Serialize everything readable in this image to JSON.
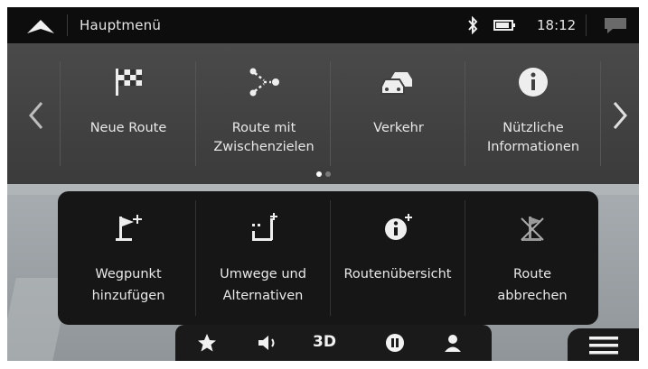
{
  "status": {
    "title": "Hauptmenü",
    "time": "18:12",
    "icons": [
      "home-arrow-icon",
      "bluetooth-icon",
      "battery-icon",
      "message-icon"
    ]
  },
  "main_menu": {
    "items": [
      {
        "label_line1": "Neue Route",
        "label_line2": "",
        "icon": "checkered-flag-icon"
      },
      {
        "label_line1": "Route mit",
        "label_line2": "Zwischenzielen",
        "icon": "waypoints-icon"
      },
      {
        "label_line1": "Verkehr",
        "label_line2": "",
        "icon": "traffic-cars-icon"
      },
      {
        "label_line1": "Nützliche",
        "label_line2": "Informationen",
        "icon": "info-icon"
      }
    ],
    "page_count": 2,
    "current_page": 1
  },
  "route_menu": {
    "items": [
      {
        "label_line1": "Wegpunkt",
        "label_line2": "hinzufügen",
        "icon": "add-waypoint-icon"
      },
      {
        "label_line1": "Umwege und",
        "label_line2": "Alternativen",
        "icon": "detours-icon"
      },
      {
        "label_line1": "Routenübersicht",
        "label_line2": "",
        "icon": "route-overview-icon"
      },
      {
        "label_line1": "Route",
        "label_line2": "abbrechen",
        "icon": "cancel-route-icon"
      }
    ]
  },
  "bottom_bar": {
    "view_mode": "3D",
    "icons": [
      "favorite-star-icon",
      "volume-icon",
      "pause-icon",
      "user-icon"
    ]
  },
  "colors": {
    "status_bar": "#0d0d0d",
    "menu_panel": "#3f3f3f",
    "route_panel": "#161616",
    "text": "#e8e8e8",
    "dot_active": "#ffffff",
    "dot_inactive": "#7a7a7a"
  }
}
